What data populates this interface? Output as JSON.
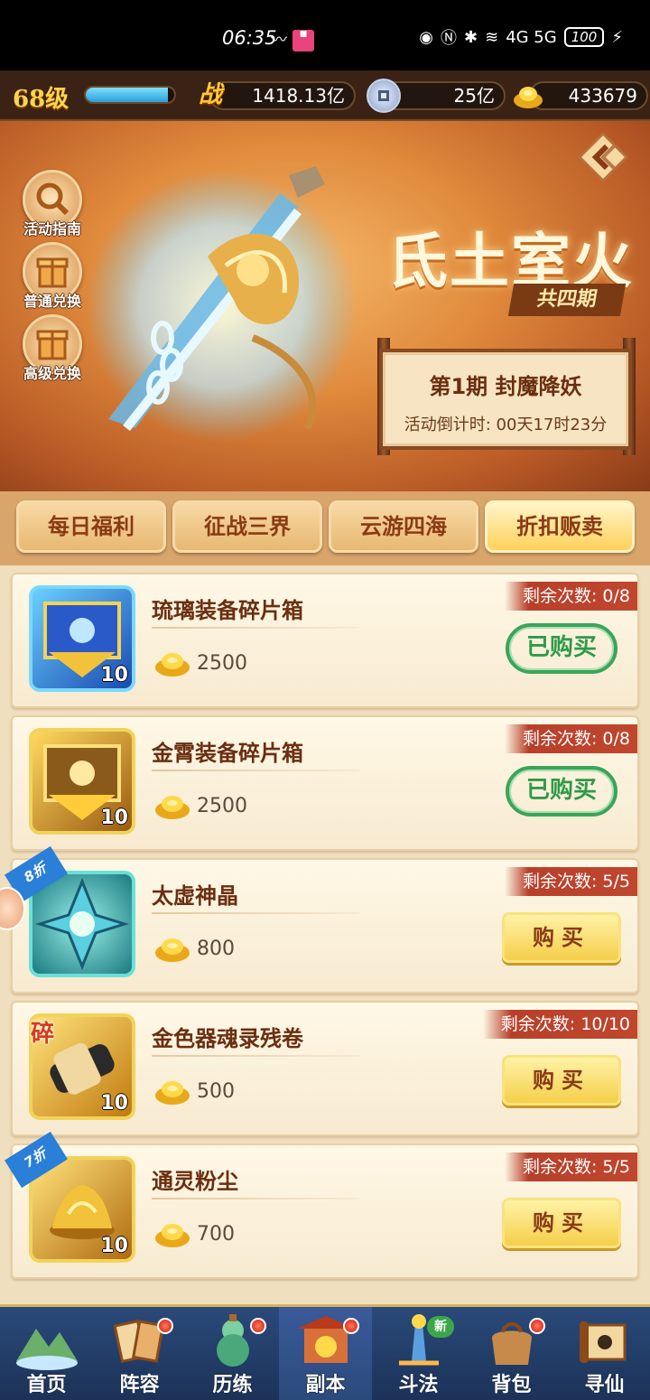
{
  "status_bar": {
    "time": "06:35",
    "network": "4G 5G",
    "battery": "100"
  },
  "resources": {
    "level": "68级",
    "xp_fraction": 0.93,
    "combat_icon": "战",
    "combat_power": "1418.13亿",
    "coins": "25亿",
    "gold_ingots": "433679"
  },
  "banner": {
    "side_buttons": [
      {
        "label": "活动指南",
        "icon": "magnifier-icon"
      },
      {
        "label": "普通兑换",
        "icon": "gift-box-icon"
      },
      {
        "label": "高级兑换",
        "icon": "gift-box-icon"
      }
    ],
    "event_title": "氐土室火",
    "event_subtitle": "共四期",
    "phase_title": "第1期 封魔降妖",
    "countdown": "活动倒计时: 00天17时23分"
  },
  "tabs": [
    {
      "label": "每日福利",
      "active": false
    },
    {
      "label": "征战三界",
      "active": false
    },
    {
      "label": "云游四海",
      "active": false
    },
    {
      "label": "折扣贩卖",
      "active": true
    }
  ],
  "items": [
    {
      "name": "琉璃装备碎片箱",
      "price": "2500",
      "remaining": "剩余次数: 0/8",
      "qty": "10",
      "state": "已购买",
      "discount": "",
      "shard": "",
      "tile_color": "#2a6ad0"
    },
    {
      "name": "金霄装备碎片箱",
      "price": "2500",
      "remaining": "剩余次数: 0/8",
      "qty": "10",
      "state": "已购买",
      "discount": "",
      "shard": "",
      "tile_color": "#c98a1a"
    },
    {
      "name": "太虚神晶",
      "price": "800",
      "remaining": "剩余次数: 5/5",
      "qty": "",
      "state": "购买",
      "discount": "8折",
      "shard": "",
      "tile_color": "#1a8a8a"
    },
    {
      "name": "金色器魂录残卷",
      "price": "500",
      "remaining": "剩余次数: 10/10",
      "qty": "10",
      "state": "购买",
      "discount": "",
      "shard": "碎",
      "tile_color": "#c98a1a"
    },
    {
      "name": "通灵粉尘",
      "price": "700",
      "remaining": "剩余次数: 5/5",
      "qty": "10",
      "state": "购买",
      "discount": "7折",
      "shard": "",
      "tile_color": "#c98a1a"
    }
  ],
  "bottom_nav": [
    {
      "label": "首页",
      "dot": false,
      "new": ""
    },
    {
      "label": "阵容",
      "dot": true,
      "new": ""
    },
    {
      "label": "历练",
      "dot": true,
      "new": ""
    },
    {
      "label": "副本",
      "dot": true,
      "new": ""
    },
    {
      "label": "斗法",
      "dot": false,
      "new": "新"
    },
    {
      "label": "背包",
      "dot": true,
      "new": ""
    },
    {
      "label": "寻仙",
      "dot": false,
      "new": ""
    }
  ]
}
